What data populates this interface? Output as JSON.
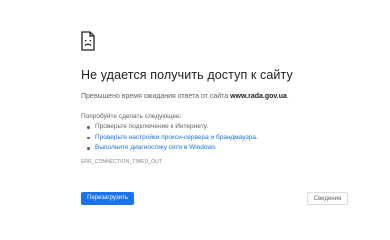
{
  "error_page": {
    "icon": "sad-document-icon",
    "headline": "Не удается получить доступ к сайту",
    "timeout_text": "Превышено время ожидания ответа от сайта",
    "host": "www.rada.gov.ua",
    "timeout_end": ".",
    "try_label": "Попробуйте сделать следующее:",
    "suggestions": [
      "Проверьте подключение к Интернету.",
      "Проверьте настройки прокси-сервера и брандмауэра.",
      "Выполните диагностику сети в Windows"
    ],
    "error_code": "ERR_CONNECTION_TIMED_OUT",
    "reload_label": "Перезагрузить",
    "details_label": "Сведения"
  },
  "colors": {
    "accent": "#1a73e8",
    "text": "#202124",
    "secondary_text": "#5f6368"
  }
}
